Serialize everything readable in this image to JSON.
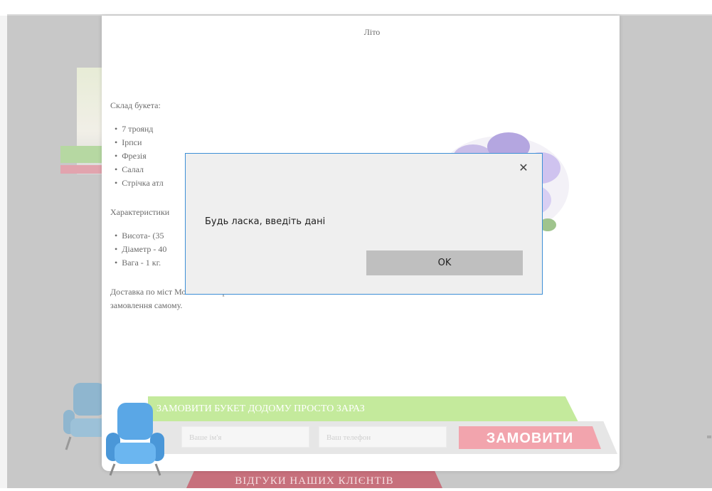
{
  "product": {
    "title": "Літо",
    "composition_heading": "Склад букета:",
    "composition": [
      "7 троянд",
      "Ірпси",
      "Фрезія",
      "Салал",
      "Стрічка атл"
    ],
    "characteristics_heading": "Характеристики",
    "characteristics": [
      "Висота- (35",
      "Діаметр - 40",
      "Вага - 1 кг."
    ],
    "delivery_text": "Доставка по міст Можливо забрати замовлення самому."
  },
  "order": {
    "banner": "ЗАМОВИТИ БУКЕТ ДОДОМУ ПРОСТО ЗАРАЗ",
    "name_placeholder": "Ваше ім'я",
    "phone_placeholder": "Ваш телефон",
    "submit_label": "ЗАМОВИТИ"
  },
  "background": {
    "reviews_banner": "ВІДГУКИ НАШИХ КЛІЄНТІВ"
  },
  "alert": {
    "close_glyph": "✕",
    "message": "Будь ласка, введіть дані",
    "ok_label": "OK"
  }
}
